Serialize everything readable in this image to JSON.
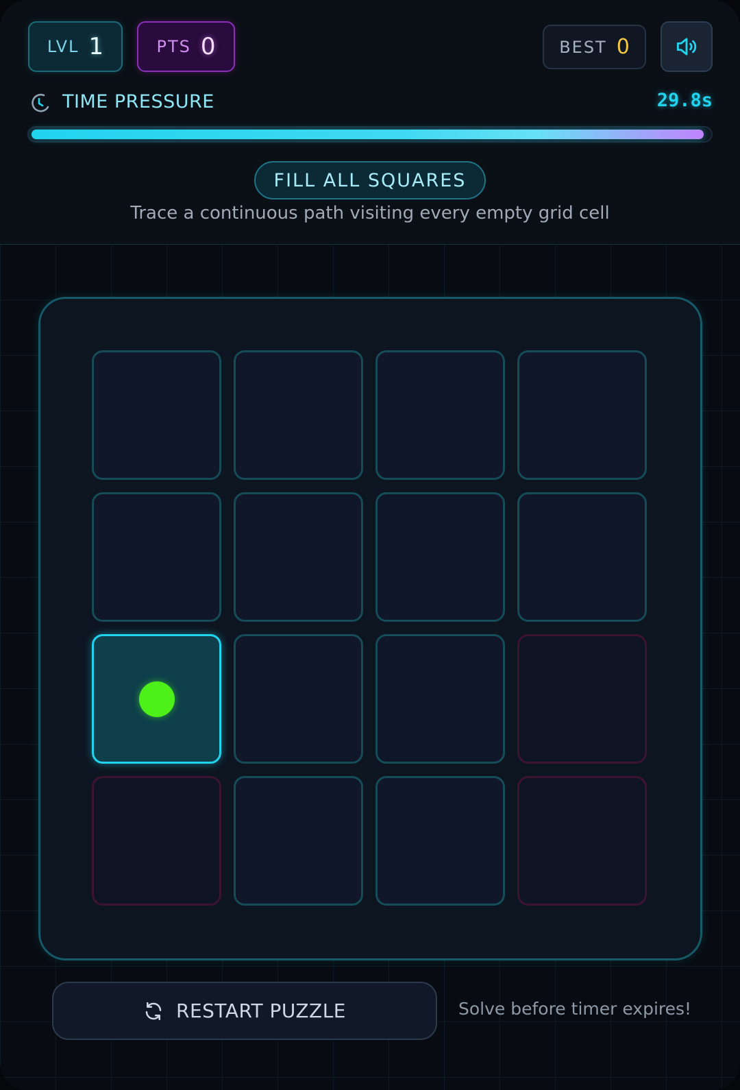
{
  "stats": {
    "level_label": "LVL",
    "level_value": "1",
    "points_label": "PTS",
    "points_value": "0",
    "best_label": "BEST",
    "best_value": "0"
  },
  "sound_icon": "speaker-icon",
  "timer": {
    "label": "TIME PRESSURE",
    "value": "29.8s",
    "icon": "timer-icon",
    "progress": 0.993
  },
  "objective": {
    "title": "FILL ALL SQUARES",
    "description": "Trace a continuous path visiting every empty grid cell"
  },
  "grid": {
    "rows": 4,
    "cols": 4,
    "cells": [
      [
        "empty",
        "empty",
        "empty",
        "empty"
      ],
      [
        "empty",
        "empty",
        "empty",
        "empty"
      ],
      [
        "start",
        "empty",
        "empty",
        "blocked"
      ],
      [
        "blocked",
        "empty",
        "empty",
        "blocked"
      ]
    ]
  },
  "footer": {
    "restart_label": "RESTART PUZZLE",
    "hint": "Solve before timer expires!"
  },
  "colors": {
    "accent": "#22d3ee",
    "accent_purple": "#c084fc",
    "token": "#4ef01a",
    "best_value": "#f5c842",
    "blocked_border": "#3d1430"
  }
}
